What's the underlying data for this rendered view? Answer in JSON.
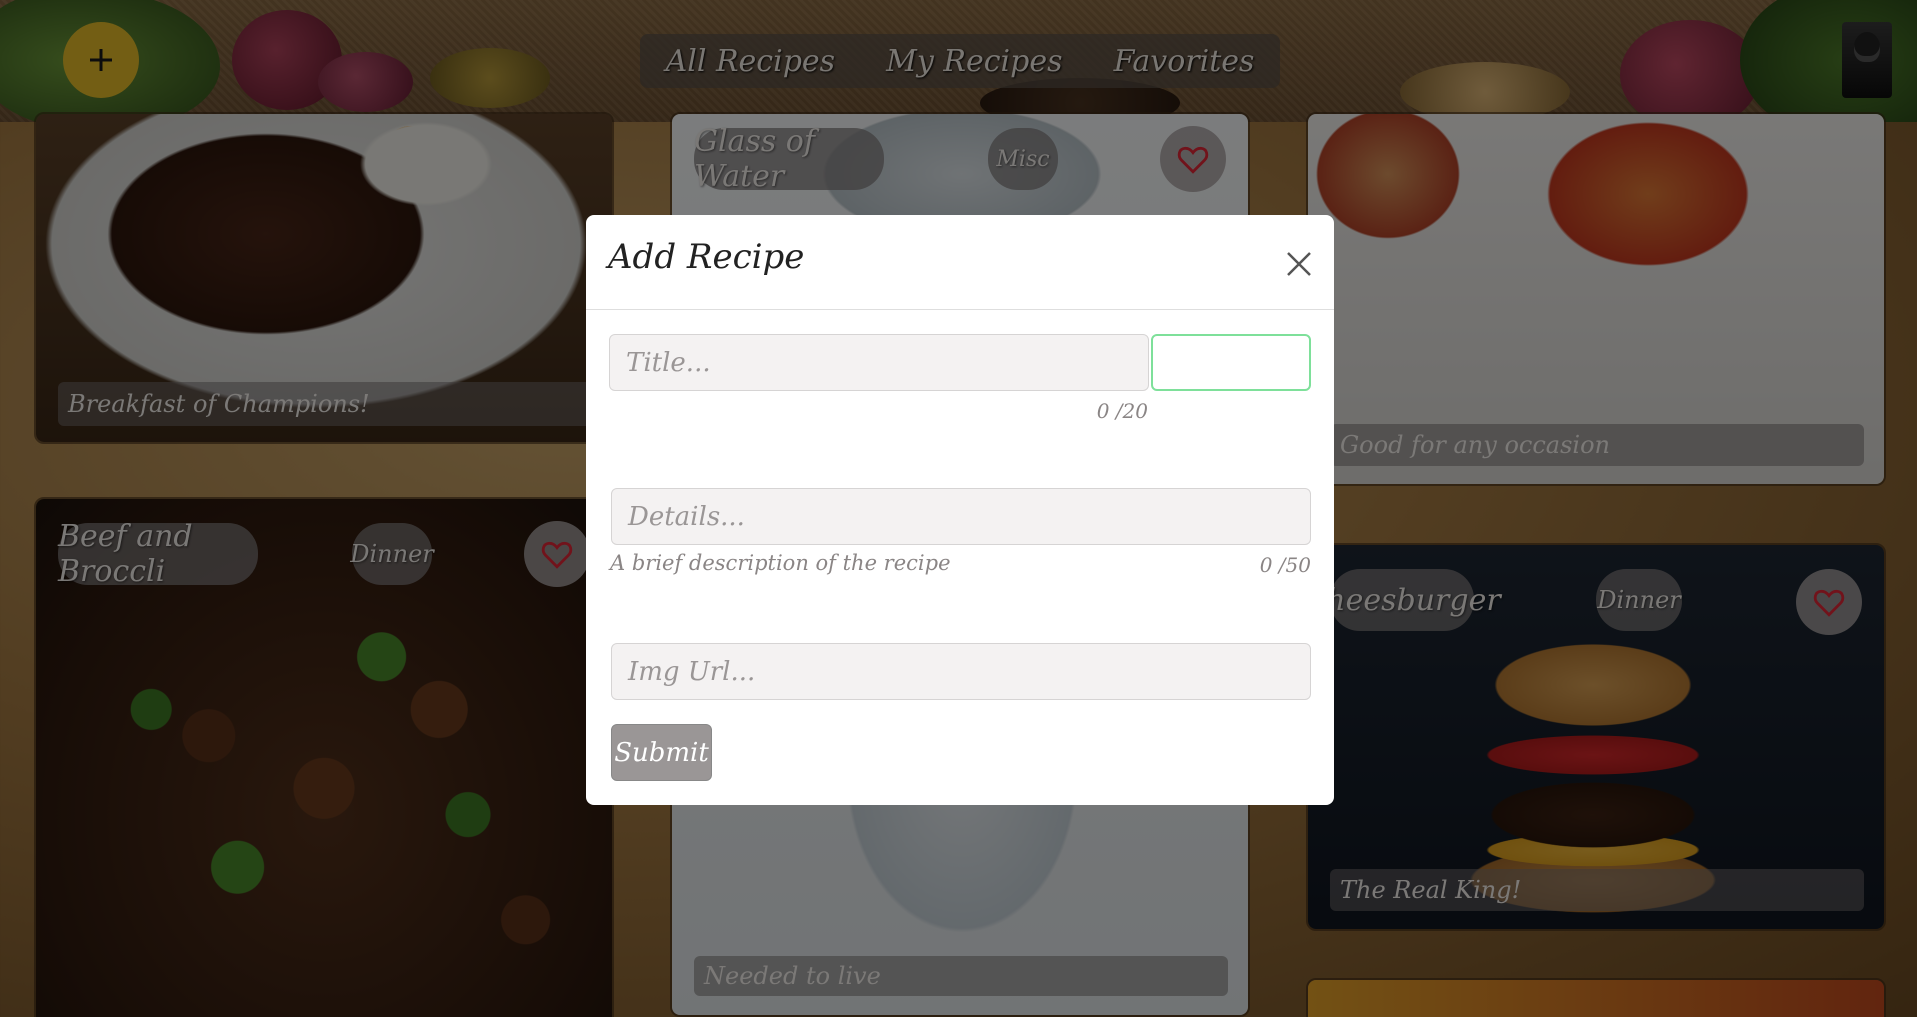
{
  "header": {
    "add_icon": "plus-icon",
    "nav": [
      "All Recipes",
      "My Recipes",
      "Favorites"
    ],
    "accent_color": "#e6bd28"
  },
  "cards": {
    "steak": {
      "caption": "Breakfast of Champions!"
    },
    "water": {
      "title": "Glass of Water",
      "category": "Misc",
      "caption": "Needed to live",
      "favorited": false
    },
    "peppers": {
      "caption": "Good for any occasion"
    },
    "beef": {
      "title": "Beef and Broccli",
      "category": "Dinner",
      "favorited": false
    },
    "burger": {
      "title": "Cheesburger",
      "category": "Dinner",
      "caption": "The Real King!",
      "favorited": false
    }
  },
  "modal": {
    "title": "Add Recipe",
    "title_placeholder": "Title...",
    "title_counter": "0 /20",
    "category_value": "",
    "details_placeholder": "Details...",
    "details_hint": "A brief description of the recipe",
    "details_counter": "0 /50",
    "img_placeholder": "Img Url...",
    "submit_label": "Submit"
  },
  "colors": {
    "heart": "#e32636",
    "focus_border": "#7ee09a",
    "submit_bg": "#9a9696"
  }
}
